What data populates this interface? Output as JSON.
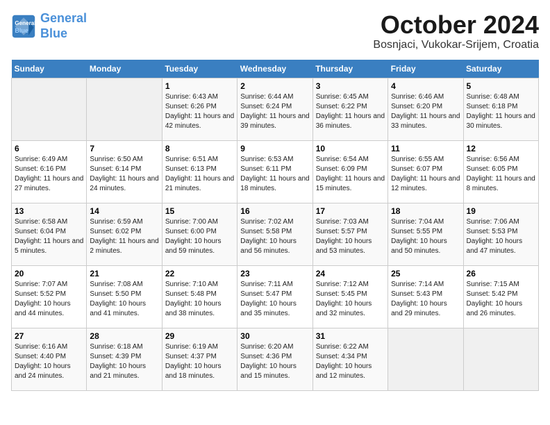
{
  "app": {
    "name_line1": "General",
    "name_line2": "Blue"
  },
  "calendar": {
    "month": "October 2024",
    "location": "Bosnjaci, Vukokar-Srijem, Croatia",
    "days_of_week": [
      "Sunday",
      "Monday",
      "Tuesday",
      "Wednesday",
      "Thursday",
      "Friday",
      "Saturday"
    ],
    "weeks": [
      [
        {
          "day": "",
          "empty": true
        },
        {
          "day": "",
          "empty": true
        },
        {
          "day": "1",
          "sunrise": "6:43 AM",
          "sunset": "6:26 PM",
          "daylight": "11 hours and 42 minutes."
        },
        {
          "day": "2",
          "sunrise": "6:44 AM",
          "sunset": "6:24 PM",
          "daylight": "11 hours and 39 minutes."
        },
        {
          "day": "3",
          "sunrise": "6:45 AM",
          "sunset": "6:22 PM",
          "daylight": "11 hours and 36 minutes."
        },
        {
          "day": "4",
          "sunrise": "6:46 AM",
          "sunset": "6:20 PM",
          "daylight": "11 hours and 33 minutes."
        },
        {
          "day": "5",
          "sunrise": "6:48 AM",
          "sunset": "6:18 PM",
          "daylight": "11 hours and 30 minutes."
        }
      ],
      [
        {
          "day": "6",
          "sunrise": "6:49 AM",
          "sunset": "6:16 PM",
          "daylight": "11 hours and 27 minutes."
        },
        {
          "day": "7",
          "sunrise": "6:50 AM",
          "sunset": "6:14 PM",
          "daylight": "11 hours and 24 minutes."
        },
        {
          "day": "8",
          "sunrise": "6:51 AM",
          "sunset": "6:13 PM",
          "daylight": "11 hours and 21 minutes."
        },
        {
          "day": "9",
          "sunrise": "6:53 AM",
          "sunset": "6:11 PM",
          "daylight": "11 hours and 18 minutes."
        },
        {
          "day": "10",
          "sunrise": "6:54 AM",
          "sunset": "6:09 PM",
          "daylight": "11 hours and 15 minutes."
        },
        {
          "day": "11",
          "sunrise": "6:55 AM",
          "sunset": "6:07 PM",
          "daylight": "11 hours and 12 minutes."
        },
        {
          "day": "12",
          "sunrise": "6:56 AM",
          "sunset": "6:05 PM",
          "daylight": "11 hours and 8 minutes."
        }
      ],
      [
        {
          "day": "13",
          "sunrise": "6:58 AM",
          "sunset": "6:04 PM",
          "daylight": "11 hours and 5 minutes."
        },
        {
          "day": "14",
          "sunrise": "6:59 AM",
          "sunset": "6:02 PM",
          "daylight": "11 hours and 2 minutes."
        },
        {
          "day": "15",
          "sunrise": "7:00 AM",
          "sunset": "6:00 PM",
          "daylight": "10 hours and 59 minutes."
        },
        {
          "day": "16",
          "sunrise": "7:02 AM",
          "sunset": "5:58 PM",
          "daylight": "10 hours and 56 minutes."
        },
        {
          "day": "17",
          "sunrise": "7:03 AM",
          "sunset": "5:57 PM",
          "daylight": "10 hours and 53 minutes."
        },
        {
          "day": "18",
          "sunrise": "7:04 AM",
          "sunset": "5:55 PM",
          "daylight": "10 hours and 50 minutes."
        },
        {
          "day": "19",
          "sunrise": "7:06 AM",
          "sunset": "5:53 PM",
          "daylight": "10 hours and 47 minutes."
        }
      ],
      [
        {
          "day": "20",
          "sunrise": "7:07 AM",
          "sunset": "5:52 PM",
          "daylight": "10 hours and 44 minutes."
        },
        {
          "day": "21",
          "sunrise": "7:08 AM",
          "sunset": "5:50 PM",
          "daylight": "10 hours and 41 minutes."
        },
        {
          "day": "22",
          "sunrise": "7:10 AM",
          "sunset": "5:48 PM",
          "daylight": "10 hours and 38 minutes."
        },
        {
          "day": "23",
          "sunrise": "7:11 AM",
          "sunset": "5:47 PM",
          "daylight": "10 hours and 35 minutes."
        },
        {
          "day": "24",
          "sunrise": "7:12 AM",
          "sunset": "5:45 PM",
          "daylight": "10 hours and 32 minutes."
        },
        {
          "day": "25",
          "sunrise": "7:14 AM",
          "sunset": "5:43 PM",
          "daylight": "10 hours and 29 minutes."
        },
        {
          "day": "26",
          "sunrise": "7:15 AM",
          "sunset": "5:42 PM",
          "daylight": "10 hours and 26 minutes."
        }
      ],
      [
        {
          "day": "27",
          "sunrise": "6:16 AM",
          "sunset": "4:40 PM",
          "daylight": "10 hours and 24 minutes."
        },
        {
          "day": "28",
          "sunrise": "6:18 AM",
          "sunset": "4:39 PM",
          "daylight": "10 hours and 21 minutes."
        },
        {
          "day": "29",
          "sunrise": "6:19 AM",
          "sunset": "4:37 PM",
          "daylight": "10 hours and 18 minutes."
        },
        {
          "day": "30",
          "sunrise": "6:20 AM",
          "sunset": "4:36 PM",
          "daylight": "10 hours and 15 minutes."
        },
        {
          "day": "31",
          "sunrise": "6:22 AM",
          "sunset": "4:34 PM",
          "daylight": "10 hours and 12 minutes."
        },
        {
          "day": "",
          "empty": true
        },
        {
          "day": "",
          "empty": true
        }
      ]
    ],
    "labels": {
      "sunrise": "Sunrise:",
      "sunset": "Sunset:",
      "daylight": "Daylight:"
    }
  }
}
